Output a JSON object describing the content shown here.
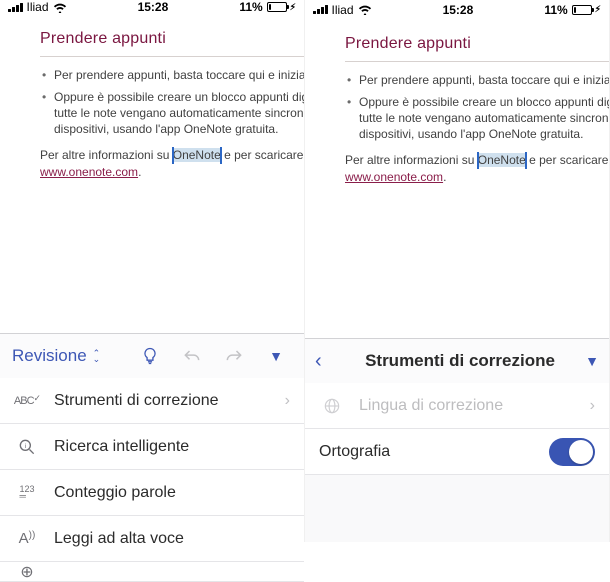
{
  "statusbar": {
    "carrier": "Iliad",
    "time": "15:28",
    "battery_pct": "11%"
  },
  "doc": {
    "heading": "Prendere appunti",
    "bullet1": "Per prendere appunti, basta toccare qui e iniziare a digit",
    "bullet2_pre": "Oppure è possibile creare un blocco appunti digitale in m",
    "bullet2_line2": "tutte le note vengano automaticamente sincronizzate in",
    "bullet2_line3_pre": "dispositivi, usando l'app OneNote gratuita.",
    "para_pre": "Per altre informazioni su ",
    "selected_word": "OneNote",
    "para_post": " e per scaricare l'app, vis",
    "link_text": "www.onenote.com",
    "period": "."
  },
  "left": {
    "tab_label": "Revisione",
    "items": {
      "proofing": "Strumenti di correzione",
      "smart_lookup": "Ricerca intelligente",
      "word_count": "Conteggio parole",
      "read_aloud": "Leggi ad alta voce"
    }
  },
  "right": {
    "panel_title": "Strumenti di correzione",
    "proofing_lang": "Lingua di correzione",
    "spelling": "Ortografia"
  }
}
